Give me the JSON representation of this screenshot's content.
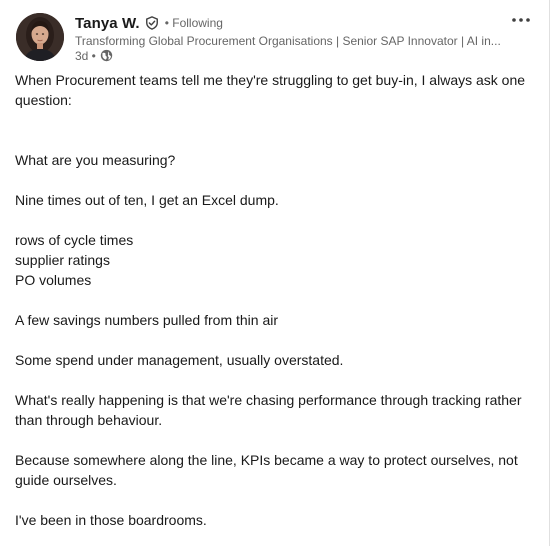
{
  "post": {
    "author": {
      "name": "Tanya W.",
      "follow_status": "• Following",
      "headline": "Transforming Global Procurement Organisations | Senior SAP Innovator | AI in...",
      "time": "3d •",
      "verified_icon": "verified-shield-icon",
      "visibility_icon": "globe-icon"
    },
    "more_icon": "ellipsis-icon",
    "lines": [
      "When Procurement teams tell me they're struggling to get buy-in, I always ask one",
      "question:",
      "",
      "",
      "What are you measuring?",
      "",
      "Nine times out of ten, I get an Excel dump.",
      "",
      "rows of cycle times",
      "supplier ratings",
      "PO volumes",
      "",
      " A few savings numbers pulled from thin air",
      "",
      " Some spend under management, usually overstated.",
      "",
      "What's really happening is that we're chasing performance through tracking rather",
      "than through behaviour.",
      "",
      "Because somewhere along the line, KPIs became a way to protect ourselves, not",
      "guide ourselves.",
      "",
      "I've been in those boardrooms."
    ]
  }
}
